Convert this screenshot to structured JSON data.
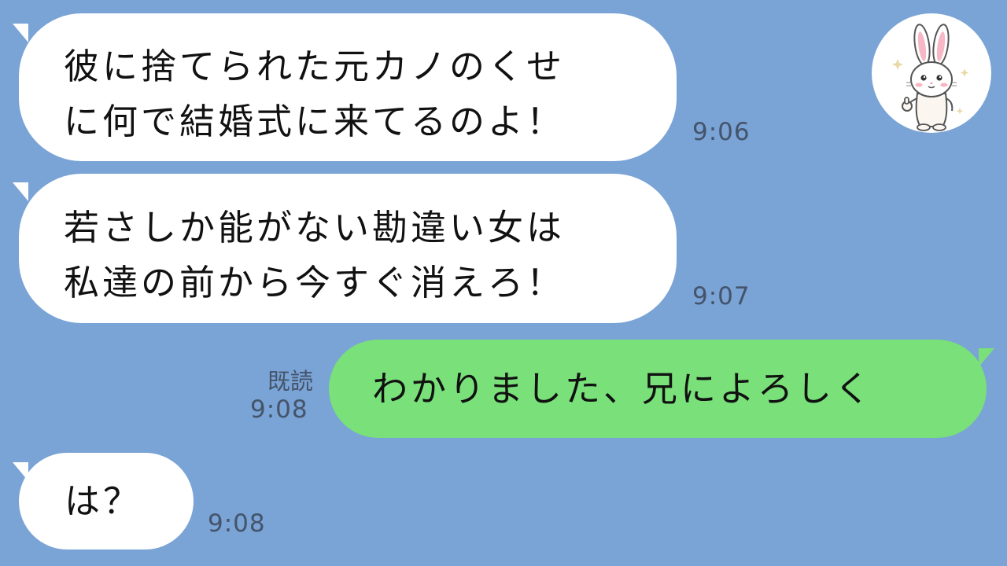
{
  "messages": [
    {
      "id": "m1",
      "direction": "incoming",
      "lines": [
        "彼に捨てられた元カノのくせ",
        "に何で結婚式に来てるのよ！"
      ],
      "time": "9:06"
    },
    {
      "id": "m2",
      "direction": "incoming",
      "lines": [
        "若さしか能がない勘違い女は",
        "私達の前から今すぐ消えろ！"
      ],
      "time": "9:07"
    },
    {
      "id": "m3",
      "direction": "outgoing",
      "lines": [
        "わかりました、兄によろしく"
      ],
      "read_label": "既読",
      "time": "9:08"
    },
    {
      "id": "m4",
      "direction": "incoming",
      "lines": [
        "は？"
      ],
      "time": "9:08"
    }
  ],
  "avatar": {
    "icon": "rabbit-thumbs-up-icon",
    "bg_color": "#ffffff"
  },
  "colors": {
    "background": "#7aa3d6",
    "incoming_bubble": "#ffffff",
    "outgoing_bubble": "#79e07a",
    "timestamp": "#44546a"
  }
}
